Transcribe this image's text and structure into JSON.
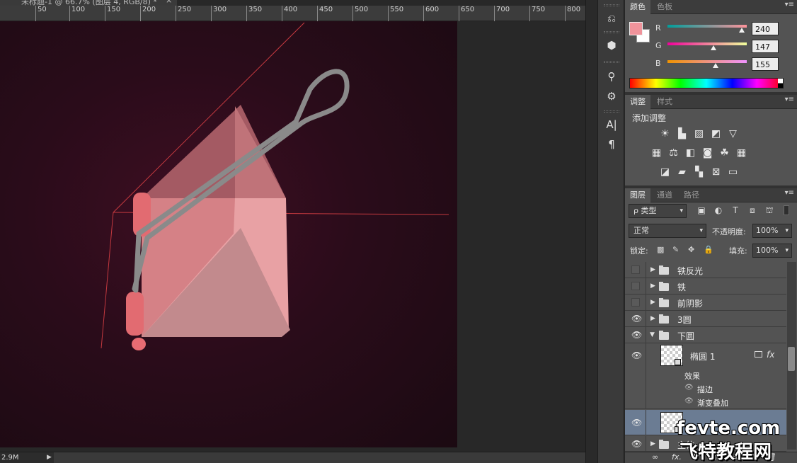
{
  "document": {
    "tab_title": "未标题-1 @ 66.7% (图层 4, RGB/8) *",
    "tab_close": "×",
    "ruler_ticks": [
      "50",
      "100",
      "150",
      "200",
      "250",
      "300",
      "350",
      "400",
      "450",
      "500",
      "550",
      "600",
      "650",
      "700",
      "750",
      "800"
    ],
    "status_zoom": "2.9M",
    "status_arrow": "▶",
    "canvas_bg_color": "#2a0c1a"
  },
  "tools": {
    "icons": [
      "history-icon",
      "3d-icon",
      "brush-preset-icon",
      "tool-preset-icon",
      "character-icon",
      "paragraph-icon"
    ],
    "glyphs": [
      "⎌",
      "⬢",
      "⚲",
      "⚙",
      "A|",
      "¶"
    ]
  },
  "color_panel": {
    "tabs": [
      "颜色",
      "色板"
    ],
    "menu": "▾≡",
    "foreground": "#f0939b",
    "background": "#ffffff",
    "channels": [
      {
        "label": "R",
        "value": "240"
      },
      {
        "label": "G",
        "value": "147"
      },
      {
        "label": "B",
        "value": "155"
      }
    ]
  },
  "adjustments_panel": {
    "tabs": [
      "调整",
      "样式"
    ],
    "menu": "▾≡",
    "title": "添加调整",
    "icon_names": [
      [
        "brightness-contrast-icon",
        "levels-icon",
        "curves-icon",
        "exposure-icon",
        "vibrance-icon"
      ],
      [
        "hue-saturation-icon",
        "color-balance-icon",
        "black-white-icon",
        "photo-filter-icon",
        "channel-mixer-icon",
        "color-lookup-icon"
      ],
      [
        "invert-icon",
        "posterize-icon",
        "threshold-icon",
        "selective-color-icon",
        "gradient-map-icon"
      ]
    ],
    "icon_glyphs": [
      [
        "☀",
        "▙",
        "▨",
        "◩",
        "▽"
      ],
      [
        "▦",
        "⚖",
        "◧",
        "◙",
        "☘",
        "▦"
      ],
      [
        "◪",
        "▰",
        "▚",
        "⊠",
        "▭"
      ]
    ]
  },
  "layers_panel": {
    "tabs": [
      "图层",
      "通道",
      "路径"
    ],
    "menu": "▾≡",
    "filter_label": "ρ 类型",
    "filter_icons": [
      "▣",
      "◐",
      "T",
      "⧈",
      "⛫"
    ],
    "blend_mode": "正常",
    "opacity_label": "不透明度:",
    "opacity_value": "100%",
    "lock_label": "锁定:",
    "lock_icons": [
      "▩",
      "✎",
      "✥",
      "🔒"
    ],
    "fill_label": "填充:",
    "fill_value": "100%",
    "caret": "▾",
    "layers": [
      {
        "name": "铁反光",
        "visible": false,
        "type": "group",
        "expanded": false
      },
      {
        "name": "铁",
        "visible": false,
        "type": "group",
        "expanded": false
      },
      {
        "name": "前阴影",
        "visible": false,
        "type": "group",
        "expanded": false
      },
      {
        "name": "3圆",
        "visible": true,
        "type": "group",
        "expanded": false
      },
      {
        "name": "下圆",
        "visible": true,
        "type": "group",
        "expanded": true
      },
      {
        "name": "椭圆 1",
        "visible": true,
        "type": "shape"
      },
      {
        "name": "效果",
        "type": "effects-header"
      },
      {
        "name": "描边",
        "type": "effect"
      },
      {
        "name": "渐变叠加",
        "type": "effect"
      },
      {
        "name": "",
        "visible": true,
        "type": "shape",
        "selected": true
      },
      {
        "name": "主体",
        "visible": true,
        "type": "group",
        "expanded": false
      }
    ],
    "fx_label": "fx",
    "eye_glyph": "👁",
    "footer_icons": [
      "∞",
      "fx.",
      "◘",
      "◐.",
      "▭",
      "▤",
      "🗑"
    ]
  },
  "watermark": {
    "line1": "fevte.com",
    "line2": "飞特教程网"
  }
}
